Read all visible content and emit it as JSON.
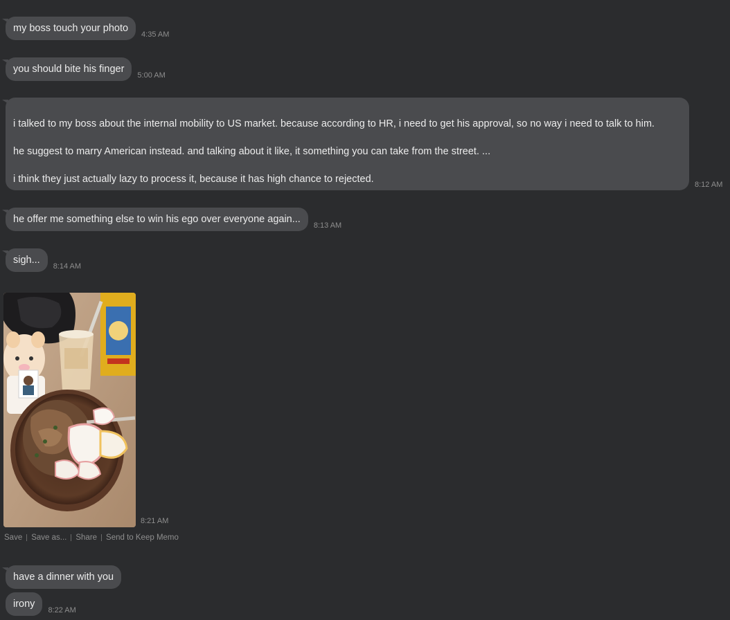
{
  "messages": [
    {
      "text": "my boss touch your photo",
      "time": "4:35 AM"
    },
    {
      "text": "you should bite his finger",
      "time": "5:00 AM"
    },
    {
      "paragraphs": [
        "i talked to my boss about the internal mobility to US market. because according to HR,  i need to get his approval, so no way i need to talk to him.",
        "he suggest to marry American instead. and talking about it like, it something you can take from the street. ...",
        "i think they just actually lazy to process it, because it has high chance to rejected."
      ],
      "time": "8:12 AM"
    },
    {
      "text": "he offer me something else to win his ego over everyone again...",
      "time": "8:13 AM"
    },
    {
      "text": "sigh...",
      "time": "8:14 AM"
    },
    {
      "text": "have a dinner with you",
      "time": ""
    },
    {
      "text": "irony",
      "time": "8:22 AM"
    }
  ],
  "photo": {
    "time": "8:21 AM",
    "actions": [
      "Save",
      "Save as...",
      "Share",
      "Send to Keep Memo"
    ]
  },
  "colors": {
    "background": "#2b2c2e",
    "bubble": "#4a4b4e",
    "text": "#ececec",
    "timestamp": "#8e8e8e"
  }
}
